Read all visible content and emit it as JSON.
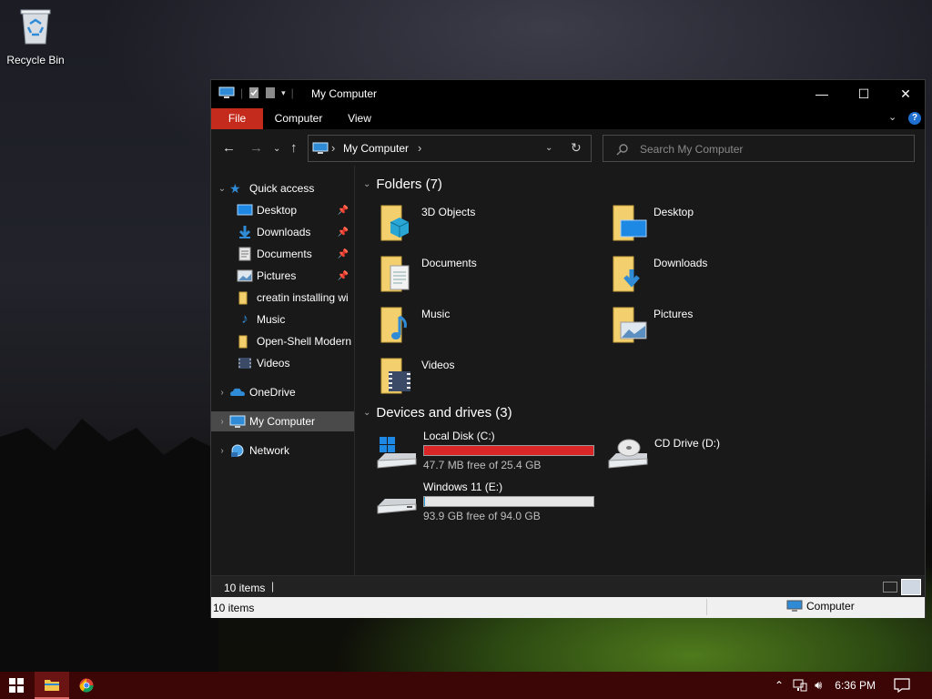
{
  "desktop": {
    "recycle_bin_label": "Recycle Bin"
  },
  "window": {
    "title": "My Computer",
    "minimize_glyph": "—",
    "maximize_glyph": "☐",
    "close_glyph": "✕"
  },
  "ribbon": {
    "tabs": [
      "File",
      "Computer",
      "View"
    ]
  },
  "address": {
    "separator": "›",
    "location": "My Computer",
    "refresh_glyph": "↻"
  },
  "search": {
    "placeholder": "Search My Computer"
  },
  "nav": {
    "quick_access": "Quick access",
    "items": [
      {
        "label": "Desktop",
        "pinned": true,
        "icon": "desktop-icon"
      },
      {
        "label": "Downloads",
        "pinned": true,
        "icon": "downloads-icon"
      },
      {
        "label": "Documents",
        "pinned": true,
        "icon": "documents-icon"
      },
      {
        "label": "Pictures",
        "pinned": true,
        "icon": "pictures-icon"
      },
      {
        "label": "creatin installing wi",
        "pinned": false,
        "icon": "folder-icon"
      },
      {
        "label": "Music",
        "pinned": false,
        "icon": "music-icon"
      },
      {
        "label": "Open-Shell Modern",
        "pinned": false,
        "icon": "folder-icon"
      },
      {
        "label": "Videos",
        "pinned": false,
        "icon": "videos-icon"
      }
    ],
    "onedrive": "OneDrive",
    "my_computer": "My Computer",
    "network": "Network"
  },
  "content": {
    "folders_header": "Folders (7)",
    "folders": [
      {
        "name": "3D Objects",
        "icon": "3d-objects-folder-icon"
      },
      {
        "name": "Desktop",
        "icon": "desktop-folder-icon"
      },
      {
        "name": "Documents",
        "icon": "documents-folder-icon"
      },
      {
        "name": "Downloads",
        "icon": "downloads-folder-icon"
      },
      {
        "name": "Music",
        "icon": "music-folder-icon"
      },
      {
        "name": "Pictures",
        "icon": "pictures-folder-icon"
      },
      {
        "name": "Videos",
        "icon": "videos-folder-icon"
      }
    ],
    "devices_header": "Devices and drives (3)",
    "drives": [
      {
        "name": "Local Disk (C:)",
        "free": "47.7 MB free of 25.4 GB",
        "used_fraction": 0.998,
        "bar_color": "#da2626",
        "icon": "windows-drive-icon"
      },
      {
        "name": "CD Drive (D:)",
        "icon": "cd-drive-icon"
      },
      {
        "name": "Windows 11 (E:)",
        "free": "93.9 GB free of 94.0 GB",
        "used_fraction": 0.001,
        "bar_color": "#26a0da",
        "icon": "hard-drive-icon"
      }
    ]
  },
  "status": {
    "items_count": "10 items",
    "items_count_lower": "10 items",
    "zone": "Computer"
  },
  "taskbar": {
    "time": "6:36 PM"
  }
}
